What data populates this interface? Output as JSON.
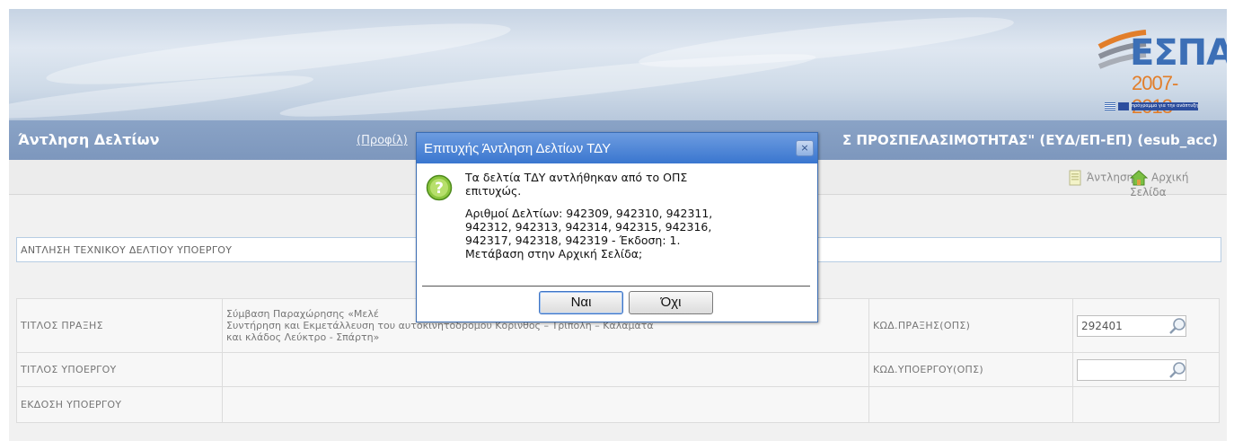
{
  "header": {
    "app_title": "Άντληση Δελτίων",
    "profile_link": "(Προφίλ)",
    "organization": "Σ ΠΡΟΣΠΕΛΑΣΙΜΟΤΗΤΑΣ\" (ΕΥΔ/ΕΠ-ΕΠ) (esub_acc)",
    "logo": {
      "espa": "ΕΣΠΑ",
      "years": "2007-2013",
      "slogan": "πρόγραμμα για την ανάπτυξη"
    }
  },
  "toolbar": {
    "fetch_label": "Άντληση",
    "home_label": "Αρχική Σελίδα"
  },
  "section": {
    "title": "ΑΝΤΛΗΣΗ ΤΕΧΝΙΚΟΥ ΔΕΛΤΙΟΥ ΥΠΟΕΡΓΟΥ"
  },
  "form": {
    "rows": [
      {
        "label": "ΤΙΤΛΟΣ ΠΡΑΞΗΣ",
        "value_lines": [
          "Σύμβαση Παραχώρησης «Μελέ",
          "Συντήρηση και Εκμετάλλευση του αυτοκινητόδρομου Κόρινθος – Τρίπολη – Καλαμάτα",
          "και κλάδος Λεύκτρο - Σπάρτη»"
        ],
        "code_label": "ΚΩΔ.ΠΡΑΞΗΣ(ΟΠΣ)",
        "code_value": "292401"
      },
      {
        "label": "ΤΙΤΛΟΣ ΥΠΟΕΡΓΟΥ",
        "code_label": "ΚΩΔ.ΥΠΟΕΡΓΟΥ(ΟΠΣ)",
        "code_value": ""
      },
      {
        "label": "ΕΚΔΟΣΗ ΥΠΟΕΡΓΟΥ"
      }
    ]
  },
  "dialog": {
    "title": "Επιτυχής Άντληση Δελτίων ΤΔΥ",
    "line1": "Τα δελτία ΤΔΥ αντλήθηκαν από το ΟΠΣ",
    "line2": "επιτυχώς.",
    "line3": "Αριθμοί Δελτίων: 942309, 942310, 942311,",
    "line4": "942312, 942313, 942314, 942315, 942316,",
    "line5": "942317, 942318, 942319 - Έκδοση: 1.",
    "line6": "Μετάβαση στην Αρχική Σελίδα;",
    "yes_label": "Ναι",
    "no_label": "Όχι",
    "close_label": "×"
  },
  "colors": {
    "titlebar": "#7d97bd",
    "dialog_title": "#3a76cf",
    "accent_orange": "#e27e2a",
    "section_border": "#b7cde3"
  }
}
